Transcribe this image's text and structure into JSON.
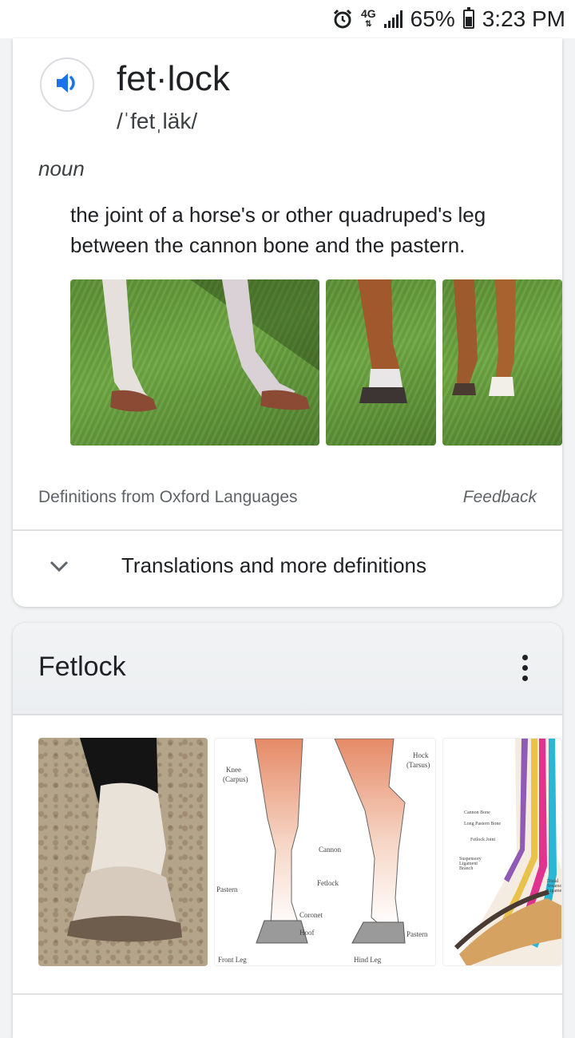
{
  "status_bar": {
    "network": "4G",
    "battery": "65%",
    "time": "3:23 PM"
  },
  "dictionary": {
    "word": "fet·lock",
    "phonetic": "/ˈfetˌläk/",
    "part_of_speech": "noun",
    "definition": "the joint of a horse's or other quadruped's leg between the cannon bone and the pastern.",
    "source": "Definitions from Oxford Languages",
    "feedback": "Feedback",
    "more": "Translations and more definitions"
  },
  "knowledge_panel": {
    "title": "Fetlock",
    "diagram": {
      "knee": "Knee",
      "carpus": "(Carpus)",
      "hock": "Hock",
      "tarsus": "(Tarsus)",
      "cannon": "Cannon",
      "fetlock": "Fetlock",
      "pastern_left": "Pastern",
      "pastern_right": "Pastern",
      "coronet": "Coronet",
      "hoof": "Hoof",
      "front_leg": "Front Leg",
      "hind_leg": "Hind Leg"
    },
    "anatomy": {
      "l1": "Cannon Bone",
      "l2": "Long Pastern Bone",
      "l3": "Fetlock Joint",
      "l4": "Suspensory Ligament Branch",
      "l5": "Distal Sesamoidean Ligament"
    }
  },
  "icons": [
    "alarm-icon",
    "signal-icon",
    "battery-icon",
    "speaker-icon",
    "chevron-down-icon",
    "more-vert-icon"
  ],
  "colors": {
    "accent": "#1a73e8",
    "text": "#202124",
    "secondary": "#5f6368",
    "background": "#f1f3f4"
  }
}
